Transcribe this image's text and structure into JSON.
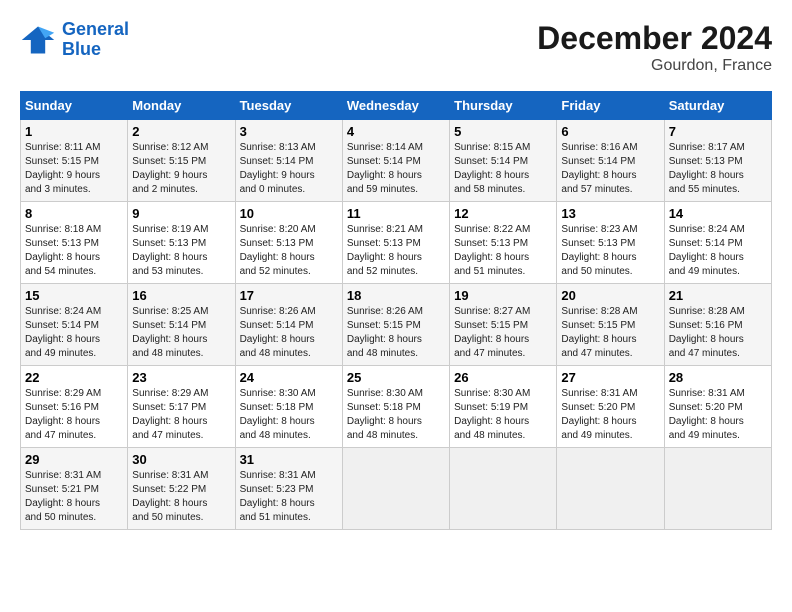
{
  "logo": {
    "line1": "General",
    "line2": "Blue"
  },
  "title": "December 2024",
  "subtitle": "Gourdon, France",
  "headers": [
    "Sunday",
    "Monday",
    "Tuesday",
    "Wednesday",
    "Thursday",
    "Friday",
    "Saturday"
  ],
  "weeks": [
    [
      {
        "day": "1",
        "info": "Sunrise: 8:11 AM\nSunset: 5:15 PM\nDaylight: 9 hours\nand 3 minutes."
      },
      {
        "day": "2",
        "info": "Sunrise: 8:12 AM\nSunset: 5:15 PM\nDaylight: 9 hours\nand 2 minutes."
      },
      {
        "day": "3",
        "info": "Sunrise: 8:13 AM\nSunset: 5:14 PM\nDaylight: 9 hours\nand 0 minutes."
      },
      {
        "day": "4",
        "info": "Sunrise: 8:14 AM\nSunset: 5:14 PM\nDaylight: 8 hours\nand 59 minutes."
      },
      {
        "day": "5",
        "info": "Sunrise: 8:15 AM\nSunset: 5:14 PM\nDaylight: 8 hours\nand 58 minutes."
      },
      {
        "day": "6",
        "info": "Sunrise: 8:16 AM\nSunset: 5:14 PM\nDaylight: 8 hours\nand 57 minutes."
      },
      {
        "day": "7",
        "info": "Sunrise: 8:17 AM\nSunset: 5:13 PM\nDaylight: 8 hours\nand 55 minutes."
      }
    ],
    [
      {
        "day": "8",
        "info": "Sunrise: 8:18 AM\nSunset: 5:13 PM\nDaylight: 8 hours\nand 54 minutes."
      },
      {
        "day": "9",
        "info": "Sunrise: 8:19 AM\nSunset: 5:13 PM\nDaylight: 8 hours\nand 53 minutes."
      },
      {
        "day": "10",
        "info": "Sunrise: 8:20 AM\nSunset: 5:13 PM\nDaylight: 8 hours\nand 52 minutes."
      },
      {
        "day": "11",
        "info": "Sunrise: 8:21 AM\nSunset: 5:13 PM\nDaylight: 8 hours\nand 52 minutes."
      },
      {
        "day": "12",
        "info": "Sunrise: 8:22 AM\nSunset: 5:13 PM\nDaylight: 8 hours\nand 51 minutes."
      },
      {
        "day": "13",
        "info": "Sunrise: 8:23 AM\nSunset: 5:13 PM\nDaylight: 8 hours\nand 50 minutes."
      },
      {
        "day": "14",
        "info": "Sunrise: 8:24 AM\nSunset: 5:14 PM\nDaylight: 8 hours\nand 49 minutes."
      }
    ],
    [
      {
        "day": "15",
        "info": "Sunrise: 8:24 AM\nSunset: 5:14 PM\nDaylight: 8 hours\nand 49 minutes."
      },
      {
        "day": "16",
        "info": "Sunrise: 8:25 AM\nSunset: 5:14 PM\nDaylight: 8 hours\nand 48 minutes."
      },
      {
        "day": "17",
        "info": "Sunrise: 8:26 AM\nSunset: 5:14 PM\nDaylight: 8 hours\nand 48 minutes."
      },
      {
        "day": "18",
        "info": "Sunrise: 8:26 AM\nSunset: 5:15 PM\nDaylight: 8 hours\nand 48 minutes."
      },
      {
        "day": "19",
        "info": "Sunrise: 8:27 AM\nSunset: 5:15 PM\nDaylight: 8 hours\nand 47 minutes."
      },
      {
        "day": "20",
        "info": "Sunrise: 8:28 AM\nSunset: 5:15 PM\nDaylight: 8 hours\nand 47 minutes."
      },
      {
        "day": "21",
        "info": "Sunrise: 8:28 AM\nSunset: 5:16 PM\nDaylight: 8 hours\nand 47 minutes."
      }
    ],
    [
      {
        "day": "22",
        "info": "Sunrise: 8:29 AM\nSunset: 5:16 PM\nDaylight: 8 hours\nand 47 minutes."
      },
      {
        "day": "23",
        "info": "Sunrise: 8:29 AM\nSunset: 5:17 PM\nDaylight: 8 hours\nand 47 minutes."
      },
      {
        "day": "24",
        "info": "Sunrise: 8:30 AM\nSunset: 5:18 PM\nDaylight: 8 hours\nand 48 minutes."
      },
      {
        "day": "25",
        "info": "Sunrise: 8:30 AM\nSunset: 5:18 PM\nDaylight: 8 hours\nand 48 minutes."
      },
      {
        "day": "26",
        "info": "Sunrise: 8:30 AM\nSunset: 5:19 PM\nDaylight: 8 hours\nand 48 minutes."
      },
      {
        "day": "27",
        "info": "Sunrise: 8:31 AM\nSunset: 5:20 PM\nDaylight: 8 hours\nand 49 minutes."
      },
      {
        "day": "28",
        "info": "Sunrise: 8:31 AM\nSunset: 5:20 PM\nDaylight: 8 hours\nand 49 minutes."
      }
    ],
    [
      {
        "day": "29",
        "info": "Sunrise: 8:31 AM\nSunset: 5:21 PM\nDaylight: 8 hours\nand 50 minutes."
      },
      {
        "day": "30",
        "info": "Sunrise: 8:31 AM\nSunset: 5:22 PM\nDaylight: 8 hours\nand 50 minutes."
      },
      {
        "day": "31",
        "info": "Sunrise: 8:31 AM\nSunset: 5:23 PM\nDaylight: 8 hours\nand 51 minutes."
      },
      null,
      null,
      null,
      null
    ]
  ]
}
